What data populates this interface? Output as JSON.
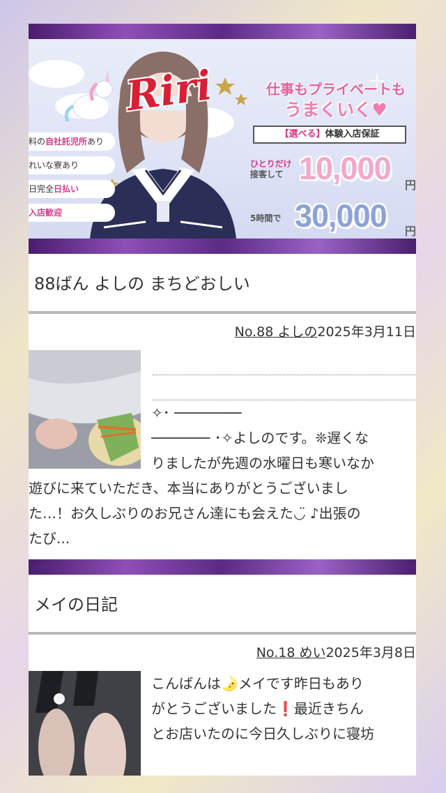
{
  "banner": {
    "logo": "Riri",
    "perks": [
      {
        "pre": "料の",
        "hl": "自社託児所",
        "post": "あり"
      },
      {
        "pre": "れいな寮あり",
        "hl": "",
        "post": ""
      },
      {
        "pre": "日完全",
        "hl": "日払い",
        "post": ""
      },
      {
        "pre": "入店歓迎",
        "hl": "",
        "post": ""
      }
    ],
    "tagline1": "仕事もプライベートも",
    "tagline2": "うまくいく♥",
    "ribbon_sel": "【選べる】",
    "ribbon_text": "体験入店保証",
    "promo1_label_a": "ひとりだけ",
    "promo1_label_b": "接客して",
    "promo1_amount": "10,000",
    "promo2_label": "5時間で",
    "promo2_amount": "30,000",
    "yen": "円"
  },
  "posts": [
    {
      "title": "88ばん よしの まちどおしい",
      "date": "2025年3月11日",
      "author": "No.88 よしの",
      "lines_right": [
        "",
        "",
        "✧･ ────────",
        "─────── ･✧よしのです。❊遅くな",
        "りましたが先週の水曜日も寒いなか"
      ],
      "lines_full": [
        "遊びに来ていただき、本当にありがとうございまし",
        "た…！お久しぶりのお兄さん達にも会えた◡̈ ♪出張の",
        "たび..."
      ]
    },
    {
      "title": "メイの日記",
      "date": "2025年3月8日",
      "author": "No.18 めい",
      "lines_right": [
        "こんばんは🌛メイです昨日もあり",
        "がとうございました❗最近きちん",
        "とお店いたのに今日久しぶりに寝坊"
      ],
      "lines_full": []
    }
  ],
  "colors": {
    "purple": "#5c2b86",
    "pink": "#d63a86"
  }
}
